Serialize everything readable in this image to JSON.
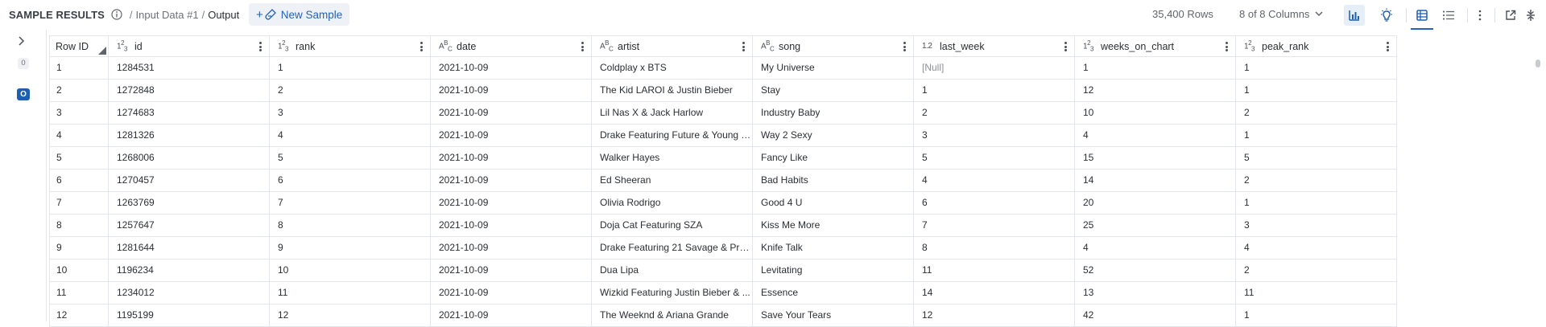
{
  "header": {
    "title": "SAMPLE RESULTS",
    "breadcrumb_input": "Input Data #1",
    "breadcrumb_sep": "/",
    "breadcrumb_current": "Output",
    "new_sample_label": "New Sample",
    "rows_count": "35,400 Rows",
    "columns_selector": "8 of 8 Columns"
  },
  "toolbar_icons": [
    "chart-icon",
    "lightbulb-icon",
    "table-view-icon",
    "list-view-icon",
    "more-options-icon",
    "external-link-icon",
    "collapse-icon"
  ],
  "rail": {
    "badge_count": "0",
    "badge_active": "O"
  },
  "columns": [
    {
      "name": "Row ID",
      "type": ""
    },
    {
      "name": "id",
      "type": "123"
    },
    {
      "name": "rank",
      "type": "123"
    },
    {
      "name": "date",
      "type": "ABC"
    },
    {
      "name": "artist",
      "type": "ABC"
    },
    {
      "name": "song",
      "type": "ABC"
    },
    {
      "name": "last_week",
      "type": "1.2"
    },
    {
      "name": "weeks_on_chart",
      "type": "123"
    },
    {
      "name": "peak_rank",
      "type": "123"
    }
  ],
  "rows": [
    [
      "1",
      "1284531",
      "1",
      "2021-10-09",
      "Coldplay x BTS",
      "My Universe",
      "[Null]",
      "1",
      "1"
    ],
    [
      "2",
      "1272848",
      "2",
      "2021-10-09",
      "The Kid LAROI & Justin Bieber",
      "Stay",
      "1",
      "12",
      "1"
    ],
    [
      "3",
      "1274683",
      "3",
      "2021-10-09",
      "Lil Nas X & Jack Harlow",
      "Industry Baby",
      "2",
      "10",
      "2"
    ],
    [
      "4",
      "1281326",
      "4",
      "2021-10-09",
      "Drake Featuring Future & Young T...",
      "Way 2 Sexy",
      "3",
      "4",
      "1"
    ],
    [
      "5",
      "1268006",
      "5",
      "2021-10-09",
      "Walker Hayes",
      "Fancy Like",
      "5",
      "15",
      "5"
    ],
    [
      "6",
      "1270457",
      "6",
      "2021-10-09",
      "Ed Sheeran",
      "Bad Habits",
      "4",
      "14",
      "2"
    ],
    [
      "7",
      "1263769",
      "7",
      "2021-10-09",
      "Olivia Rodrigo",
      "Good 4 U",
      "6",
      "20",
      "1"
    ],
    [
      "8",
      "1257647",
      "8",
      "2021-10-09",
      "Doja Cat Featuring SZA",
      "Kiss Me More",
      "7",
      "25",
      "3"
    ],
    [
      "9",
      "1281644",
      "9",
      "2021-10-09",
      "Drake Featuring 21 Savage & Proj...",
      "Knife Talk",
      "8",
      "4",
      "4"
    ],
    [
      "10",
      "1196234",
      "10",
      "2021-10-09",
      "Dua Lipa",
      "Levitating",
      "11",
      "52",
      "2"
    ],
    [
      "11",
      "1234012",
      "11",
      "2021-10-09",
      "Wizkid Featuring Justin Bieber & ...",
      "Essence",
      "14",
      "13",
      "11"
    ],
    [
      "12",
      "1195199",
      "12",
      "2021-10-09",
      "The Weeknd & Ariana Grande",
      "Save Your Tears",
      "12",
      "42",
      "1"
    ]
  ]
}
